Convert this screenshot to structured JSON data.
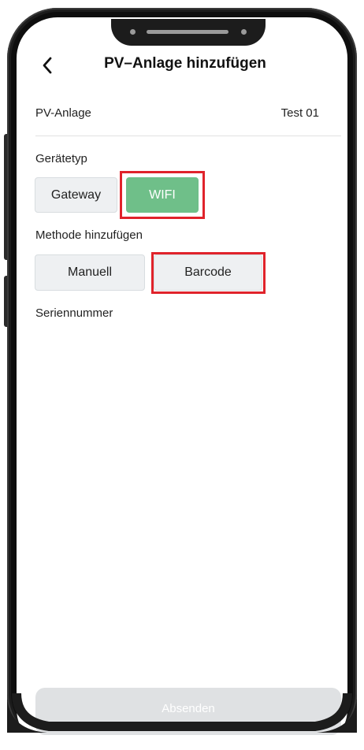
{
  "header": {
    "title": "PV–Anlage hinzufügen",
    "back_icon": "chevron-left-icon"
  },
  "pv_row": {
    "label": "PV-Anlage",
    "value": "Test 01"
  },
  "device_type": {
    "label": "Gerätetyp",
    "options": [
      "Gateway",
      "WIFI"
    ],
    "selected": "WIFI"
  },
  "add_method": {
    "label": "Methode hinzufügen",
    "options": [
      "Manuell",
      "Barcode"
    ]
  },
  "serial": {
    "label": "Seriennummer"
  },
  "submit": {
    "label": "Absenden"
  },
  "colors": {
    "selected_green": "#6fbf89",
    "highlight_red": "#e0232b",
    "button_grey": "#eef0f2"
  }
}
